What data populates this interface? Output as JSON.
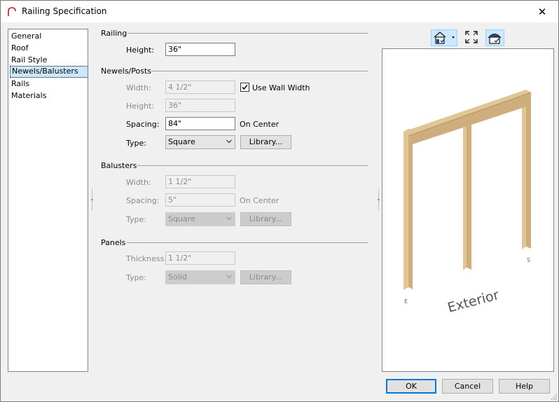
{
  "window": {
    "title": "Railing Specification",
    "close_glyph": "✕"
  },
  "nav": {
    "items": [
      {
        "label": "General"
      },
      {
        "label": "Roof"
      },
      {
        "label": "Rail Style"
      },
      {
        "label": "Newels/Balusters"
      },
      {
        "label": "Rails"
      },
      {
        "label": "Materials"
      }
    ],
    "selected": "Newels/Balusters"
  },
  "railing": {
    "section": "Railing",
    "height_label": "Height:",
    "height_value": "36\""
  },
  "newels": {
    "section": "Newels/Posts",
    "width_label": "Width:",
    "width_value": "4 1/2\"",
    "use_wall_width_label": "Use Wall Width",
    "use_wall_width_checked": true,
    "height_label": "Height:",
    "height_value": "36\"",
    "spacing_label": "Spacing:",
    "spacing_value": "84\"",
    "spacing_suffix": "On Center",
    "type_label": "Type:",
    "type_value": "Square",
    "library_label": "Library..."
  },
  "balusters": {
    "section": "Balusters",
    "width_label": "Width:",
    "width_value": "1 1/2\"",
    "spacing_label": "Spacing:",
    "spacing_value": "5\"",
    "spacing_suffix": "On Center",
    "type_label": "Type:",
    "type_value": "Square",
    "library_label": "Library..."
  },
  "panels": {
    "section": "Panels",
    "thickness_label": "Thickness:",
    "thickness_value": "1 1/2\"",
    "type_label": "Type:",
    "type_value": "Solid",
    "library_label": "Library..."
  },
  "preview": {
    "tools": [
      "view-options-icon",
      "fit-to-window-icon",
      "show-room-icon"
    ],
    "labels": {
      "exterior": "Exterior",
      "left_letter": "E",
      "right_letter": "S"
    },
    "colors": {
      "wood": "#cfae7e",
      "wood_dark": "#a98a5c",
      "wood_light": "#e0c595"
    }
  },
  "buttons": {
    "ok": "OK",
    "cancel": "Cancel",
    "help": "Help"
  }
}
